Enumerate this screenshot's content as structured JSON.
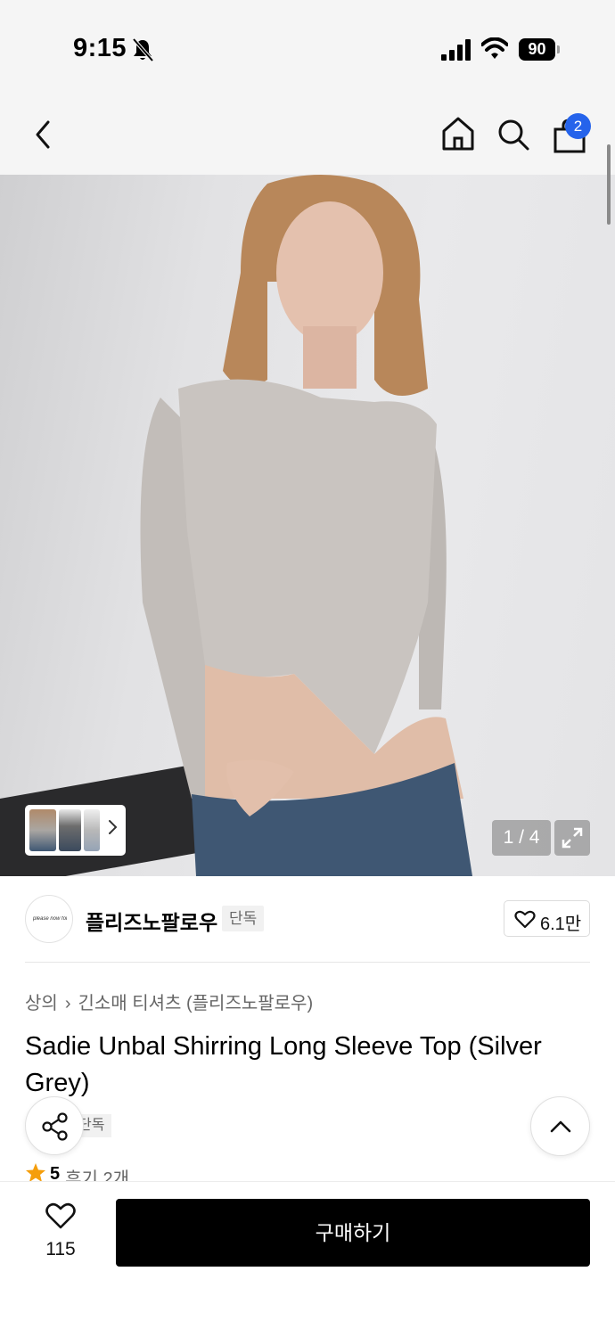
{
  "status_bar": {
    "time": "9:15",
    "battery": "90",
    "icons": [
      "bell-slash-icon",
      "cellular-signal-icon",
      "wifi-icon",
      "battery-icon"
    ]
  },
  "header": {
    "icons": [
      "chevron-left-icon",
      "home-icon",
      "search-icon",
      "shopping-bag-icon"
    ],
    "cart_count": "2"
  },
  "gallery": {
    "counter": "1 / 4",
    "thumbnail_count": 3,
    "expand_icon": "expand-icon"
  },
  "brand": {
    "logo_text": "please now follow",
    "name": "플리즈노팔로우",
    "tag": "단독",
    "likes": "6.1만"
  },
  "product": {
    "breadcrumb": [
      "상의",
      "긴소매 티셔츠 (플리즈노팔로우)"
    ],
    "title": "Sadie Unbal Shirring Long Sleeve Top (Silver Grey)",
    "tag": "단독",
    "rating": "5",
    "reviews": "후기 2개"
  },
  "bottom_bar": {
    "wish_count": "115",
    "buy_label": "구매하기"
  },
  "colors": {
    "accent_badge": "#2563eb",
    "buy_button": "#000000",
    "star": "#f59e0b"
  }
}
